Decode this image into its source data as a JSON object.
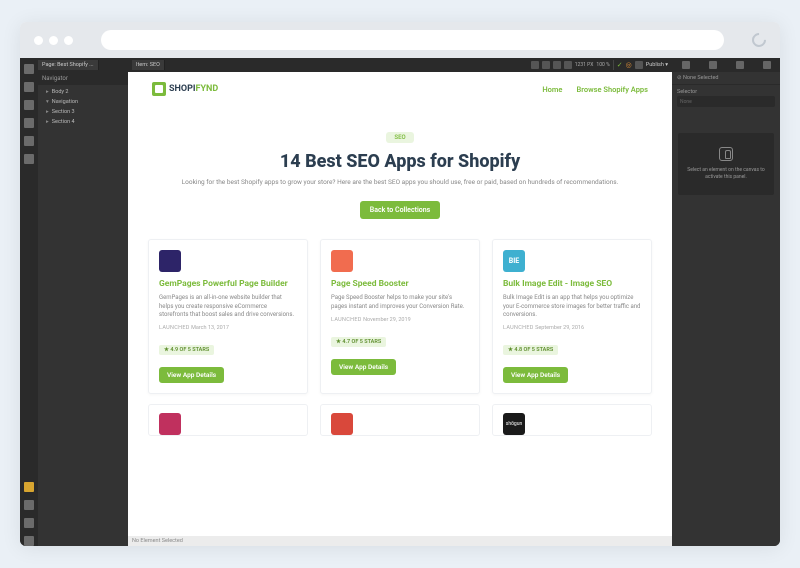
{
  "topbar": {
    "page_label": "Page: Best Shopify ...",
    "item_label": "Item: SEO",
    "dimensions": "1231 PX",
    "zoom": "100 %",
    "publish": "Publish ▾"
  },
  "navigator": {
    "title": "Navigator",
    "items": [
      "Body 2",
      "Navigation",
      "Section 3",
      "Section 4"
    ]
  },
  "site": {
    "logo_text_a": "SHOPI",
    "logo_text_b": "FYND",
    "nav": {
      "home": "Home",
      "browse": "Browse Shopify Apps"
    },
    "hero": {
      "badge": "SEO",
      "title": "14 Best SEO Apps for Shopify",
      "subtitle": "Looking for the best Shopify apps to grow your store? Here are the best SEO apps you should use, free or paid, based on hundreds of recommendations.",
      "cta": "Back to Collections"
    },
    "cards": [
      {
        "title": "GemPages Powerful Page Builder",
        "desc": "GemPages is an all-in-one website builder that helps you create responsive eCommerce storefronts that boost sales and drive conversions.",
        "launched": "March 13, 2017",
        "stars": "4.9 OF 5 STARS",
        "btn": "View App Details",
        "color": "#2d2468"
      },
      {
        "title": "Page Speed Booster",
        "desc": "Page Speed Booster helps to make your site's pages instant and improves your Conversion Rate.",
        "launched": "November 29, 2019",
        "stars": "4.7 OF 5 STARS",
        "btn": "View App Details",
        "color": "#f16c4f"
      },
      {
        "title": "Bulk Image Edit - Image SEO",
        "desc": "Bulk Image Edit is an app that helps you optimize your E-commerce store images for better traffic and conversions.",
        "launched": "September 29, 2016",
        "stars": "4.8 OF 5 STARS",
        "btn": "View App Details",
        "color": "#3eb0d0"
      }
    ],
    "cards2_colors": [
      "#c0305e",
      "#d9483b",
      "#1a1a1a"
    ],
    "launched_label": "LAUNCHED"
  },
  "statusbar": "No Element Selected",
  "rpanel": {
    "none_selected": "⊘ None Selected",
    "selector_label": "Selector",
    "selector_placeholder": "None",
    "hint": "Select an element on the canvas to activate this panel."
  }
}
